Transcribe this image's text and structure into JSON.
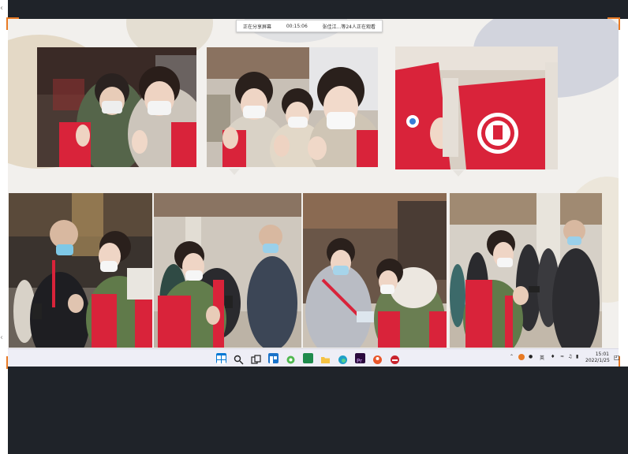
{
  "share_bar": {
    "status": "正在分享屏幕",
    "timer": "00:15:06",
    "participants": "张佳江...等24人正在观看"
  },
  "photos": [
    {
      "name": "photo-top-left",
      "desc": ""
    },
    {
      "name": "photo-top-middle",
      "desc": ""
    },
    {
      "name": "photo-top-right",
      "desc": ""
    },
    {
      "name": "photo-bottom-1",
      "desc": ""
    },
    {
      "name": "photo-bottom-2",
      "desc": ""
    },
    {
      "name": "photo-bottom-3",
      "desc": ""
    },
    {
      "name": "photo-bottom-4",
      "desc": ""
    }
  ],
  "taskbar": {
    "icons": [
      "windows-start-icon",
      "search-icon",
      "task-view-icon",
      "widgets-icon",
      "chat-icon",
      "app-green-icon",
      "file-explorer-icon",
      "edge-browser-icon",
      "premiere-icon",
      "app-orange-icon",
      "app-red-icon"
    ],
    "ime_label": "英",
    "time": "15:01",
    "date": "2022/1/25"
  },
  "colors": {
    "accent_orange": "#e87a24",
    "frame_dark": "#1f2329",
    "slide_bg": "#f2f0ed",
    "vest_red": "#d9233a"
  }
}
